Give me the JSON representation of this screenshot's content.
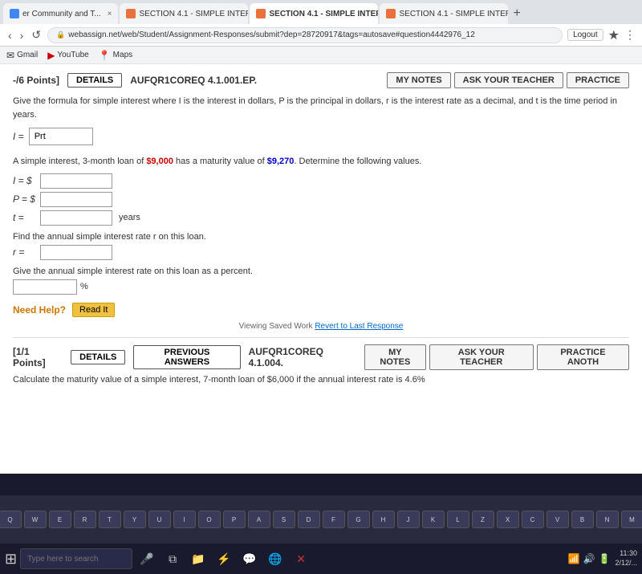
{
  "browser": {
    "tabs": [
      {
        "label": "er Community and T...",
        "icon": "blue",
        "active": false
      },
      {
        "label": "SECTION 4.1 - SIMPLE INTER...",
        "icon": "orange",
        "active": false
      },
      {
        "label": "SECTION 4.1 - SIMPLE INTER...",
        "icon": "orange",
        "active": true
      },
      {
        "label": "SECTION 4.1 - SIMPLE INTER...",
        "icon": "orange",
        "active": false
      }
    ],
    "address": "webassign.net/web/Student/Assignment-Responses/submit?dep=28720917&tags=autosave#question4442976_12",
    "logout_label": "Logout",
    "bookmarks": [
      "Gmail",
      "YouTube",
      "Maps"
    ]
  },
  "question1": {
    "points": "-/6 Points]",
    "details_label": "DETAILS",
    "code": "AUFQR1COREQ 4.1.001.EP.",
    "my_notes_label": "MY NOTES",
    "ask_teacher_label": "ASK YOUR TEACHER",
    "practice_label": "PRACTICE",
    "description": "Give the formula for simple interest where I is the interest in dollars, P is the principal in dollars, r is the interest rate as a decimal, and t is the time period in years.",
    "formula_label": "I =",
    "formula_value": "Prt",
    "loan_text": "A simple interest, 3-month loan of $9,000 has a maturity value of $9,270. Determine the following values.",
    "loan_amount": "$9,000",
    "maturity_value": "$9,270",
    "i_label": "I = $",
    "p_label": "P = $",
    "t_label": "t =",
    "years_label": "years",
    "find_r_text": "Find the annual simple interest rate r on this loan.",
    "r_label": "r =",
    "give_rate_text": "Give the annual simple interest rate on this loan as a percent.",
    "percent_sign": "%",
    "need_help_label": "Need Help?",
    "read_it_label": "Read It",
    "saved_work_text": "Viewing Saved Work",
    "revert_label": "Revert to Last Response"
  },
  "question2": {
    "points": "[1/1 Points]",
    "details_label": "DETAILS",
    "prev_answers_label": "PREVIOUS ANSWERS",
    "code": "AUFQR1COREQ 4.1.004.",
    "my_notes_label": "MY NOTES",
    "ask_teacher_label": "ASK YOUR TEACHER",
    "practice_label": "PRACTICE ANOTH",
    "description": "Calculate the maturity value of a simple interest, 7-month loan of $6,000 if the annual interest rate is 4.6%"
  },
  "taskbar": {
    "search_placeholder": "Type here to search",
    "time": "11:30",
    "date": "2/12/...",
    "icons": [
      "⊞",
      "🔍",
      "📁",
      "⚡",
      "💬",
      "🌐",
      "❌"
    ]
  },
  "keyboard": {
    "keys": [
      "Q",
      "W",
      "E",
      "R",
      "T",
      "Y",
      "U",
      "I",
      "O",
      "P",
      "A",
      "S",
      "D",
      "F",
      "G",
      "H",
      "J",
      "K",
      "L",
      "Z",
      "X",
      "C",
      "V",
      "B",
      "N",
      "M"
    ]
  }
}
